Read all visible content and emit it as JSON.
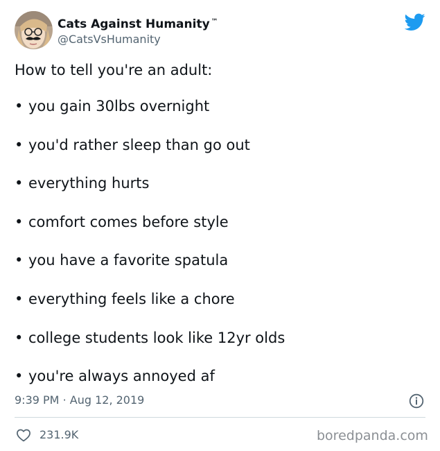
{
  "colors": {
    "text": "#0f1419",
    "secondary_text": "#536471",
    "twitter_blue": "#1d9bf0",
    "divider": "#cfd9de",
    "watermark": "#8b8f94"
  },
  "author": {
    "display_name": "Cats Against Humanity",
    "trademark": "™",
    "handle": "@CatsVsHumanity"
  },
  "icons": {
    "platform": "twitter-bird-icon",
    "info": "info-icon",
    "like": "heart-icon"
  },
  "tweet": {
    "intro": "How to tell you're an adult:",
    "bullet_symbol": "•",
    "items": [
      "you gain 30lbs overnight",
      "you'd rather sleep than go out",
      "everything hurts",
      "comfort comes before style",
      "you have a favorite spatula",
      "everything feels like a chore",
      "college students look like 12yr olds",
      "you're always annoyed af"
    ]
  },
  "meta": {
    "time": "9:39 PM",
    "separator": "·",
    "date": "Aug 12, 2019"
  },
  "engagement": {
    "likes": "231.9K"
  },
  "watermark": "boredpanda.com"
}
